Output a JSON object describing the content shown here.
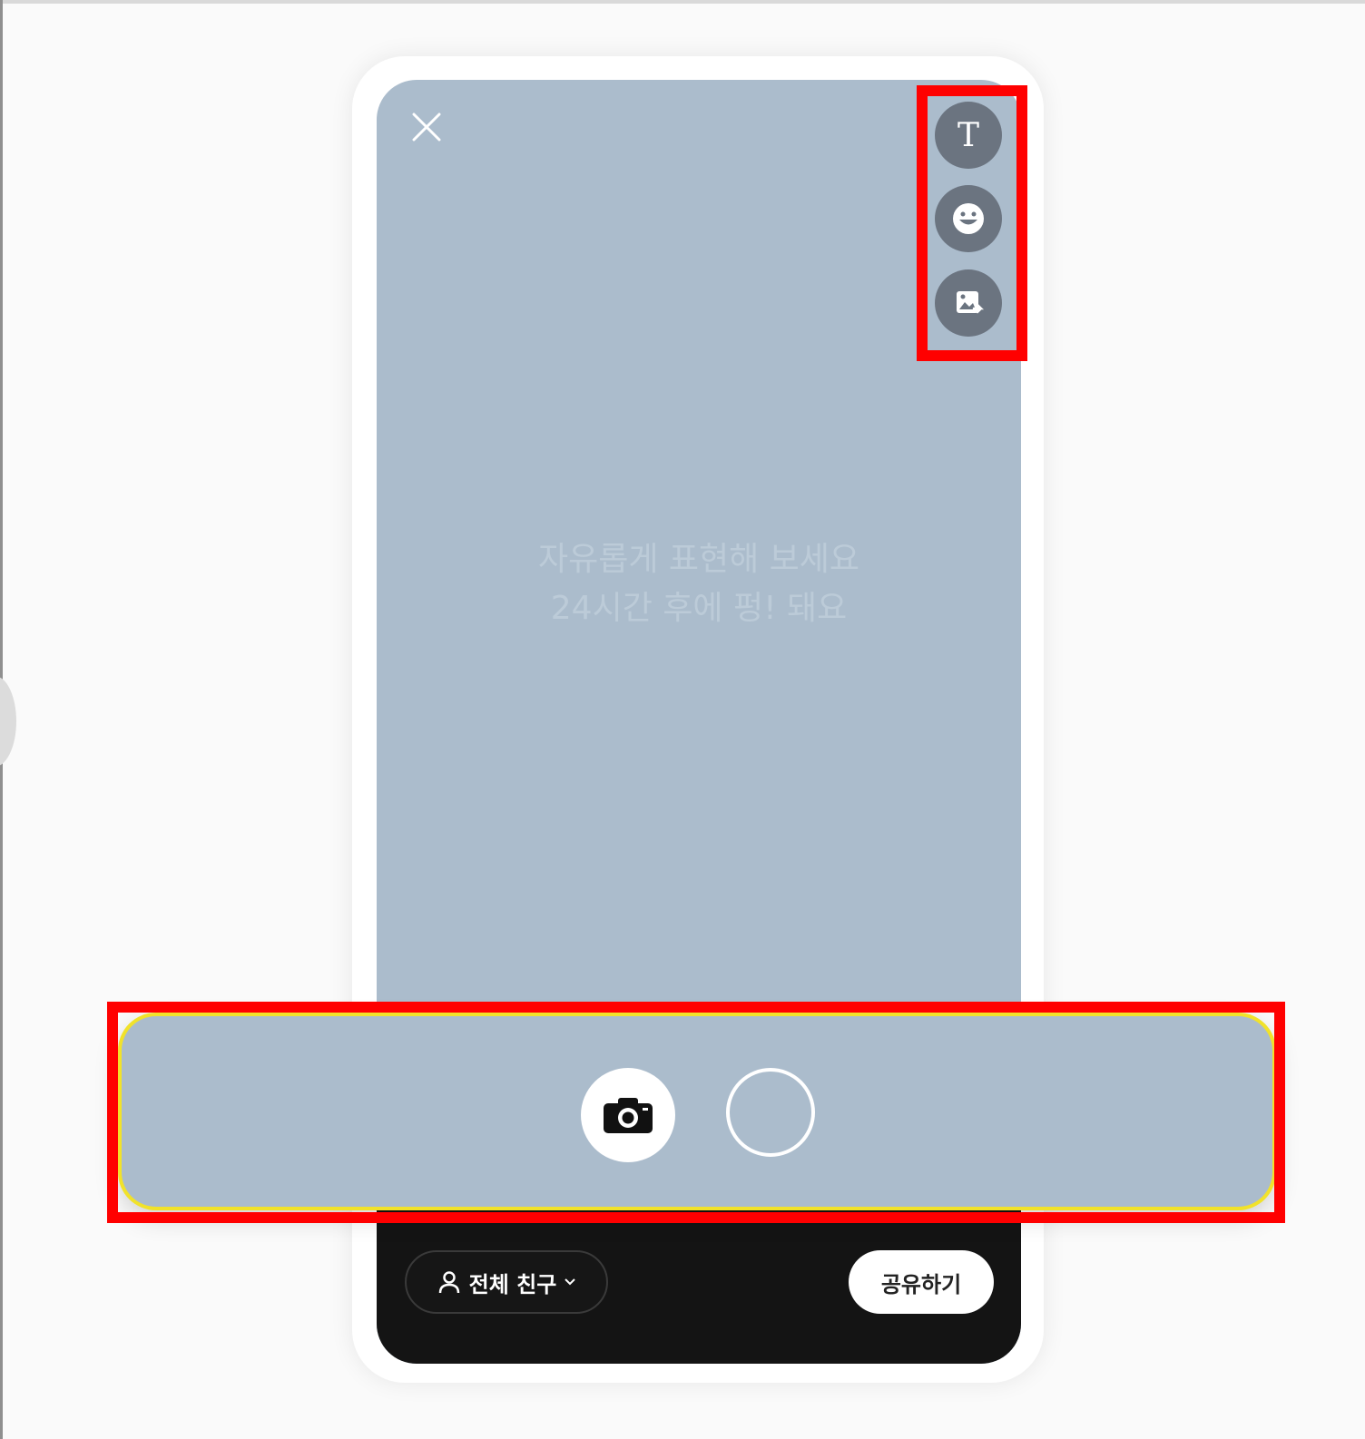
{
  "colors": {
    "screen_background": "#abbccc",
    "tool_button": "#6b7480",
    "bottom_bar": "#141414",
    "highlight": "#ff0000",
    "panel_outline": "#f1e22a"
  },
  "header": {
    "close_icon": "close-icon"
  },
  "tools": {
    "text_label": "T",
    "items": [
      "text-icon",
      "sticker-icon",
      "photo-icon"
    ]
  },
  "canvas": {
    "hint_line1": "자유롭게 표현해 보세요",
    "hint_line2": "24시간 후에 펑! 돼요"
  },
  "capture": {
    "camera_icon": "camera-icon",
    "shutter_icon": "shutter-circle-icon"
  },
  "footer": {
    "audience_label": "전체 친구",
    "share_label": "공유하기"
  }
}
